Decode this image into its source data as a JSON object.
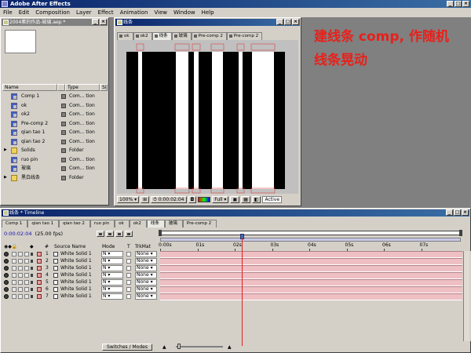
{
  "app": {
    "title": "Adobe After Effects"
  },
  "menu": [
    "File",
    "Edit",
    "Composition",
    "Layer",
    "Effect",
    "Animation",
    "View",
    "Window",
    "Help"
  ],
  "project": {
    "title": "2004素的作品-玻璃.aep *",
    "columns": [
      "Name",
      "Type",
      "Siz"
    ],
    "items": [
      {
        "name": "Comp 1",
        "type": "Com... tion",
        "kind": "comp"
      },
      {
        "name": "ok",
        "type": "Com... tion",
        "kind": "comp"
      },
      {
        "name": "ok2",
        "type": "Com... tion",
        "kind": "comp"
      },
      {
        "name": "Pre-comp 2",
        "type": "Com... tion",
        "kind": "comp"
      },
      {
        "name": "qian tao 1",
        "type": "Com... tion",
        "kind": "comp"
      },
      {
        "name": "qian tao 2",
        "type": "Com... tion",
        "kind": "comp"
      },
      {
        "name": "Solids",
        "type": "Folder",
        "kind": "folder"
      },
      {
        "name": "ruo pin",
        "type": "Com... tion",
        "kind": "comp"
      },
      {
        "name": "玻璃",
        "type": "Com... tion",
        "kind": "comp"
      },
      {
        "name": "黑白线条",
        "type": "Folder",
        "kind": "folder"
      }
    ]
  },
  "comp_window": {
    "title": "线条",
    "tabs": [
      {
        "label": "ok",
        "active": false
      },
      {
        "label": "ok2",
        "active": false
      },
      {
        "label": "线条",
        "active": true
      },
      {
        "label": "玻璃",
        "active": false
      },
      {
        "label": "Pre-comp 2",
        "active": false
      },
      {
        "label": "Pre-comp 2",
        "active": false
      }
    ],
    "zoom": "100%",
    "timecode": "0:00:02:04",
    "resolution": "Full",
    "camera": "Active"
  },
  "annotation": {
    "line1": "建线条 comp, 作随机",
    "line2": "线条晃动"
  },
  "timeline": {
    "title": "线条 * Timeline",
    "tabs": [
      {
        "label": "Comp 1",
        "active": false
      },
      {
        "label": "qian tao 1",
        "active": false
      },
      {
        "label": "qian tao 2",
        "active": false
      },
      {
        "label": "ruo pin",
        "active": false
      },
      {
        "label": "ok",
        "active": false
      },
      {
        "label": "ok2",
        "active": false
      },
      {
        "label": "线条",
        "active": true
      },
      {
        "label": "玻璃",
        "active": false
      },
      {
        "label": "Pre-comp 2",
        "active": false
      }
    ],
    "timecode": "0:00:02:04",
    "fps": "(25.00 fps)",
    "ruler": [
      "0:00s",
      "01s",
      "02s",
      "03s",
      "04s",
      "05s",
      "06s",
      "07s"
    ],
    "columns": {
      "source": "Source Name",
      "mode": "Mode",
      "t": "T",
      "trkmat": "TrkMat",
      "num": "#"
    },
    "layers": [
      {
        "num": "1",
        "name": "White Solid 1",
        "mode": "N",
        "trkmat": "None"
      },
      {
        "num": "2",
        "name": "White Solid 1",
        "mode": "N",
        "trkmat": "None"
      },
      {
        "num": "3",
        "name": "White Solid 1",
        "mode": "N",
        "trkmat": "None"
      },
      {
        "num": "4",
        "name": "White Solid 1",
        "mode": "N",
        "trkmat": "None"
      },
      {
        "num": "5",
        "name": "White Solid 1",
        "mode": "N",
        "trkmat": "None"
      },
      {
        "num": "6",
        "name": "White Solid 1",
        "mode": "N",
        "trkmat": "None"
      },
      {
        "num": "7",
        "name": "White Solid 1",
        "mode": "N",
        "trkmat": "None"
      }
    ],
    "switches_label": "Switches / Modes"
  }
}
